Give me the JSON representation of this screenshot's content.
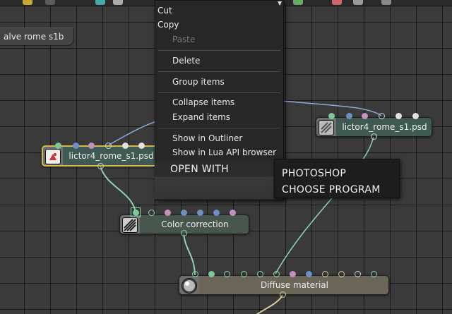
{
  "tab": {
    "label": "alve rome s1b"
  },
  "context_menu": {
    "cut": "Cut",
    "copy": "Copy",
    "items": [
      {
        "label": "Paste",
        "enabled": false
      },
      {
        "label": "Delete",
        "enabled": true
      },
      {
        "label": "Group items",
        "enabled": true
      },
      {
        "label": "Collapse items",
        "enabled": true
      },
      {
        "label": "Expand items",
        "enabled": true
      },
      {
        "label": "Show in Outliner",
        "enabled": true
      },
      {
        "label": "Show in Lua API browser",
        "enabled": true
      }
    ],
    "open_with": "OPEN WITH"
  },
  "submenu": {
    "items": [
      "PHOTOSHOP",
      "CHOOSE PROGRAM"
    ]
  },
  "nodes": {
    "left_psd": {
      "label": "lictor4_rome_s1.psd",
      "icon": "image-file-icon",
      "selected": true
    },
    "right_psd": {
      "label": "lictor4_rome_s1.psd",
      "icon": "image-file-icon"
    },
    "color_correction": {
      "label": "Color correction",
      "icon": "color-correction-icon"
    },
    "diffuse_material": {
      "label": "Diffuse material",
      "icon": "material-sphere-icon"
    }
  },
  "colors": {
    "wire": "#8fd4b0",
    "wire_blue": "#8da8d8",
    "wire_yellow": "#d8cf9a",
    "psd_node": "#3f5a52",
    "cc_node": "#47574e",
    "material_node": "#6a6658",
    "selection": "#d4b84a"
  }
}
